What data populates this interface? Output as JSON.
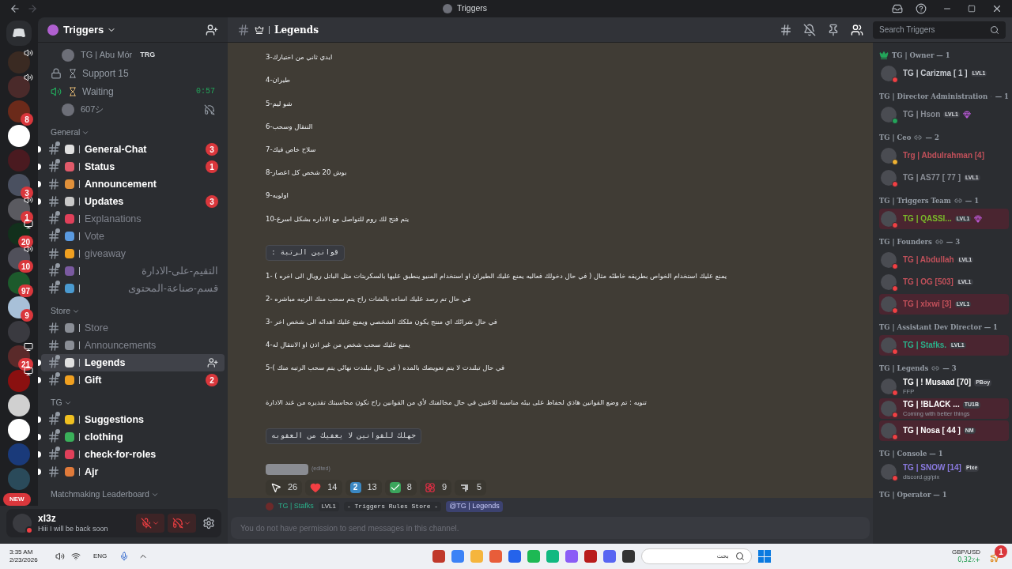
{
  "window": {
    "title": "Triggers"
  },
  "servers": [
    {
      "color": "#3a2a22",
      "kind": "voice"
    },
    {
      "color": "#4a2a2a",
      "kind": "voice"
    },
    {
      "color": "#6b2a1a",
      "kind": "plain",
      "badge": "8"
    },
    {
      "color": "#ffffff",
      "kind": "plain"
    },
    {
      "color": "#4a1a20",
      "kind": "plain"
    },
    {
      "color": "#4a5060",
      "kind": "plain",
      "badge": "3"
    },
    {
      "color": "#5a5a60",
      "kind": "voice",
      "badge": "1"
    },
    {
      "color": "#12301c",
      "kind": "screen",
      "badge": "20"
    },
    {
      "color": "#50505a",
      "kind": "voice",
      "badge": "10"
    },
    {
      "color": "#1d5a2c",
      "kind": "plain",
      "badge": "97"
    },
    {
      "color": "#a8c0d8",
      "kind": "plain",
      "badge": "9"
    },
    {
      "color": "#3a3a40",
      "kind": "plain"
    },
    {
      "color": "#5a2a2a",
      "kind": "screen",
      "badge": "21"
    },
    {
      "color": "#8a1010",
      "kind": "screen"
    },
    {
      "color": "#d0d0d0",
      "kind": "plain"
    },
    {
      "color": "#ffffff",
      "kind": "plain"
    },
    {
      "color": "#1a3a7a",
      "kind": "plain"
    },
    {
      "color": "#2a4a5a",
      "kind": "plain"
    }
  ],
  "new_pill": "NEW",
  "server": {
    "name": "Triggers"
  },
  "voice": [
    {
      "kind": "user",
      "name": "TG | Abu Mór",
      "tag": "TRG"
    },
    {
      "kind": "channel",
      "name": "Support 15",
      "locked": true,
      "color": "#9aa0a8"
    },
    {
      "kind": "channel",
      "name": "Waiting",
      "locked": false,
      "color": "#d8b070",
      "time": "0:57"
    },
    {
      "kind": "user",
      "name": "607シ",
      "deafened": true
    }
  ],
  "categories": [
    {
      "name": "General",
      "channels": [
        {
          "name": "General-Chat",
          "unread": true,
          "selected": false,
          "threads": true,
          "color": "#e0e0e0",
          "badge": "3"
        },
        {
          "name": "Status",
          "unread": true,
          "selected": false,
          "threads": true,
          "color": "#e05a6a",
          "badge": "1"
        },
        {
          "name": "Announcement",
          "unread": true,
          "selected": false,
          "threads": false,
          "color": "#e0903a"
        },
        {
          "name": "Updates",
          "unread": true,
          "selected": false,
          "threads": false,
          "color": "#c8c8c8",
          "badge": "3"
        },
        {
          "name": "Explanations",
          "unread": false,
          "selected": false,
          "threads": true,
          "color": "#e0405a"
        },
        {
          "name": "Vote",
          "unread": false,
          "selected": false,
          "threads": true,
          "color": "#5a9ae0"
        },
        {
          "name": "giveaway",
          "unread": false,
          "selected": false,
          "threads": false,
          "color": "#f0a020"
        },
        {
          "name": "التقيم-على-الادارة",
          "unread": false,
          "selected": false,
          "threads": true,
          "color": "#7a5aa0"
        },
        {
          "name": "قسم-صناعة-المحتوى",
          "unread": false,
          "selected": false,
          "threads": true,
          "color": "#4a9ad0"
        }
      ]
    },
    {
      "name": "Store",
      "channels": [
        {
          "name": "Store",
          "unread": false,
          "selected": false,
          "threads": false,
          "color": "#8a8e96"
        },
        {
          "name": "Announcements",
          "unread": false,
          "selected": false,
          "threads": false,
          "color": "#8a8e96"
        },
        {
          "name": "Legends",
          "unread": true,
          "selected": true,
          "threads": true,
          "color": "#e0e0e0"
        },
        {
          "name": "Gift",
          "unread": true,
          "selected": false,
          "threads": true,
          "color": "#f0a020",
          "badge": "2"
        }
      ]
    },
    {
      "name": "TG",
      "channels": [
        {
          "name": "Suggestions",
          "unread": true,
          "selected": false,
          "threads": true,
          "color": "#f0c020"
        },
        {
          "name": "clothing",
          "unread": true,
          "selected": false,
          "threads": true,
          "color": "#3ab05a"
        },
        {
          "name": "check-for-roles",
          "unread": true,
          "selected": false,
          "threads": true,
          "color": "#e0405a"
        },
        {
          "name": "Ajr",
          "unread": true,
          "selected": false,
          "threads": false,
          "color": "#e07a3a"
        }
      ]
    },
    {
      "name": "Matchmaking Leaderboard"
    }
  ],
  "user": {
    "name": "xl3z",
    "status_text": "Hiii I will be back soon",
    "muted": true,
    "deafened": true
  },
  "channel": {
    "name": "Legends"
  },
  "search": {
    "placeholder": "Search Triggers"
  },
  "message": {
    "lines": [
      {
        "kind": "text",
        "text": "ايدي ثاني من اختيارك-3"
      },
      {
        "kind": "text",
        "text": "طيران-4"
      },
      {
        "kind": "text",
        "text": "شو ليم-5"
      },
      {
        "kind": "text",
        "text": "التنقال وسحب-6"
      },
      {
        "kind": "text",
        "text": "سلاح خاص فيك-7"
      },
      {
        "kind": "text",
        "text": "بوش 20 شخص كل اعصار-8"
      },
      {
        "kind": "text",
        "text": "اولويه-9"
      },
      {
        "kind": "text",
        "text": "يتم فتح لك روم  للتواصل مع الاداره بشكل اسرع-10"
      },
      {
        "kind": "gap"
      },
      {
        "kind": "code",
        "text": "قوانين الرتبة :"
      },
      {
        "kind": "text",
        "text": "يمنع عليك استخدام الخواص بطريقه خاطئه مثال ( في حال دخولك فعاليه يمنع عليك الطيران او استخدام المنيو ينطبق عليها بالسكربتات مثل الباتل رويال الى اخره ) -1"
      },
      {
        "kind": "text",
        "text": "في حال تم رصد عليك اساءه بالشات راح يتم سحب منك الرتبه مباشره -2"
      },
      {
        "kind": "text",
        "text": "في حال شرائك اي منتج يكون ملكك الشخصي ويمنع عليك اهدائه الى شخص اخر -3"
      },
      {
        "kind": "text",
        "text": "يمنع عليك سحب شخص من غير اذن او الانتقال له-4"
      },
      {
        "kind": "text",
        "text": "في حال تبلندت لا يتم تعويضك بالمده ( في حال تبلندت نهائي يتم سحب الرتبه منك )-5"
      },
      {
        "kind": "gap"
      },
      {
        "kind": "text",
        "text": "تنويه : تم وضع القوانين هاذي لحفاظ على بيئه مناسبه للاعبين في حال مخالفتك لأي من القوانين راح تكون محاسبتك تقديره من عند الادارة"
      },
      {
        "kind": "gap"
      },
      {
        "kind": "code",
        "text": "جهلك للقوانين لا يعفيك من العقوبه"
      }
    ],
    "edited": "(edited)",
    "reactions": [
      {
        "kind": "pointer",
        "count": "26",
        "selected": false
      },
      {
        "kind": "heart",
        "count": "14",
        "selected": false
      },
      {
        "kind": "keycap",
        "label": "2",
        "count": "13",
        "selected": false
      },
      {
        "kind": "check",
        "count": "8",
        "selected": false
      },
      {
        "kind": "rose",
        "count": "9",
        "selected": false
      },
      {
        "kind": "glyph",
        "count": "5",
        "selected": false
      }
    ]
  },
  "reply": {
    "author": "TG | Stafks",
    "tag": "LVL1",
    "code": "- Triggers Rules Store -",
    "mention": "@TG | Legends"
  },
  "composer": {
    "placeholder": "You do not have permission to send messages in this channel."
  },
  "member_groups": [
    {
      "name": "TG | Owner — 1",
      "crown": true,
      "members": [
        {
          "name": "TG | Carizma [ 1 ]",
          "color": "#c8ccd2",
          "kind": "dnd",
          "tag": "LVL1",
          "boost": false,
          "nameplate": false
        }
      ]
    },
    {
      "name": "TG | Director Administration",
      "count": "— 1",
      "linked": true,
      "members": [
        {
          "name": "TG | Hson",
          "color": "#8a8e96",
          "kind": "online",
          "tag": "LVL1",
          "boost": true,
          "nameplate": false
        }
      ]
    },
    {
      "name": "TG | Ceo",
      "count": "— 2",
      "linked": true,
      "members": [
        {
          "name": "Trg | Abdulrahman [4]",
          "color": "#c0505a",
          "kind": "idle",
          "boost": false,
          "nameplate": false
        },
        {
          "name": "TG | AS77 [ 77 ]",
          "color": "#8a8e96",
          "kind": "dnd",
          "tag": "LVL1",
          "boost": false,
          "nameplate": false
        }
      ]
    },
    {
      "name": "TG | Triggers Team",
      "count": "— 1",
      "linked": true,
      "members": [
        {
          "name": "TG | QASSI...",
          "color": "#7aba2a",
          "kind": "dnd",
          "tag": "LVL1",
          "boost": true,
          "nameplate": true
        }
      ]
    },
    {
      "name": "TG | Founders",
      "count": "— 3",
      "linked": true,
      "members": [
        {
          "name": "TG | Abdullah",
          "color": "#c0505a",
          "kind": "dnd",
          "tag": "LVL1",
          "boost": false,
          "nameplate": false
        },
        {
          "name": "TG | OG [503]",
          "color": "#c0505a",
          "kind": "dnd",
          "tag": "LVL1",
          "boost": false,
          "nameplate": false
        },
        {
          "name": "TG | xlxwi [3]",
          "color": "#c0505a",
          "kind": "dnd",
          "tag": "LVL1",
          "boost": false,
          "nameplate": true
        }
      ]
    },
    {
      "name": "TG | Assistant Dev Director — 1",
      "members": [
        {
          "name": "TG | Stafks.",
          "color": "#2ab08a",
          "kind": "dnd",
          "tag": "LVL1",
          "boost": false,
          "nameplate": true
        }
      ]
    },
    {
      "name": "TG | Legends",
      "count": "— 3",
      "linked": true,
      "members": [
        {
          "name": "TG | ! Musaad [70]",
          "color": "#ffffff",
          "kind": "dnd",
          "tag": "PBoy",
          "sub": "FFP",
          "boost": false,
          "nameplate": false
        },
        {
          "name": "TG | !BLACK ...",
          "color": "#ffffff",
          "kind": "dnd",
          "tag": "TU1B",
          "sub": "Coming with better things",
          "boost": false,
          "nameplate": true
        },
        {
          "name": "TG | Nosa [ 44 ]",
          "color": "#ffffff",
          "kind": "dnd",
          "tag": "NM",
          "boost": false,
          "nameplate": true
        }
      ]
    },
    {
      "name": "TG | Console — 1",
      "members": [
        {
          "name": "TG | SNOW [14]",
          "color": "#8a7ae0",
          "kind": "dnd",
          "tag": "Pixe",
          "sub": "discord.gg/pix",
          "boost": false,
          "nameplate": false
        }
      ]
    },
    {
      "name": "TG | Operator — 1"
    }
  ],
  "taskbar": {
    "time": "3:35 AM",
    "date": "2/23/2026",
    "language": "ENG",
    "search_placeholder": "بحث",
    "ticker": "GBP/USD",
    "ticker_change": "0,32٪+",
    "notification_badge": "1"
  }
}
